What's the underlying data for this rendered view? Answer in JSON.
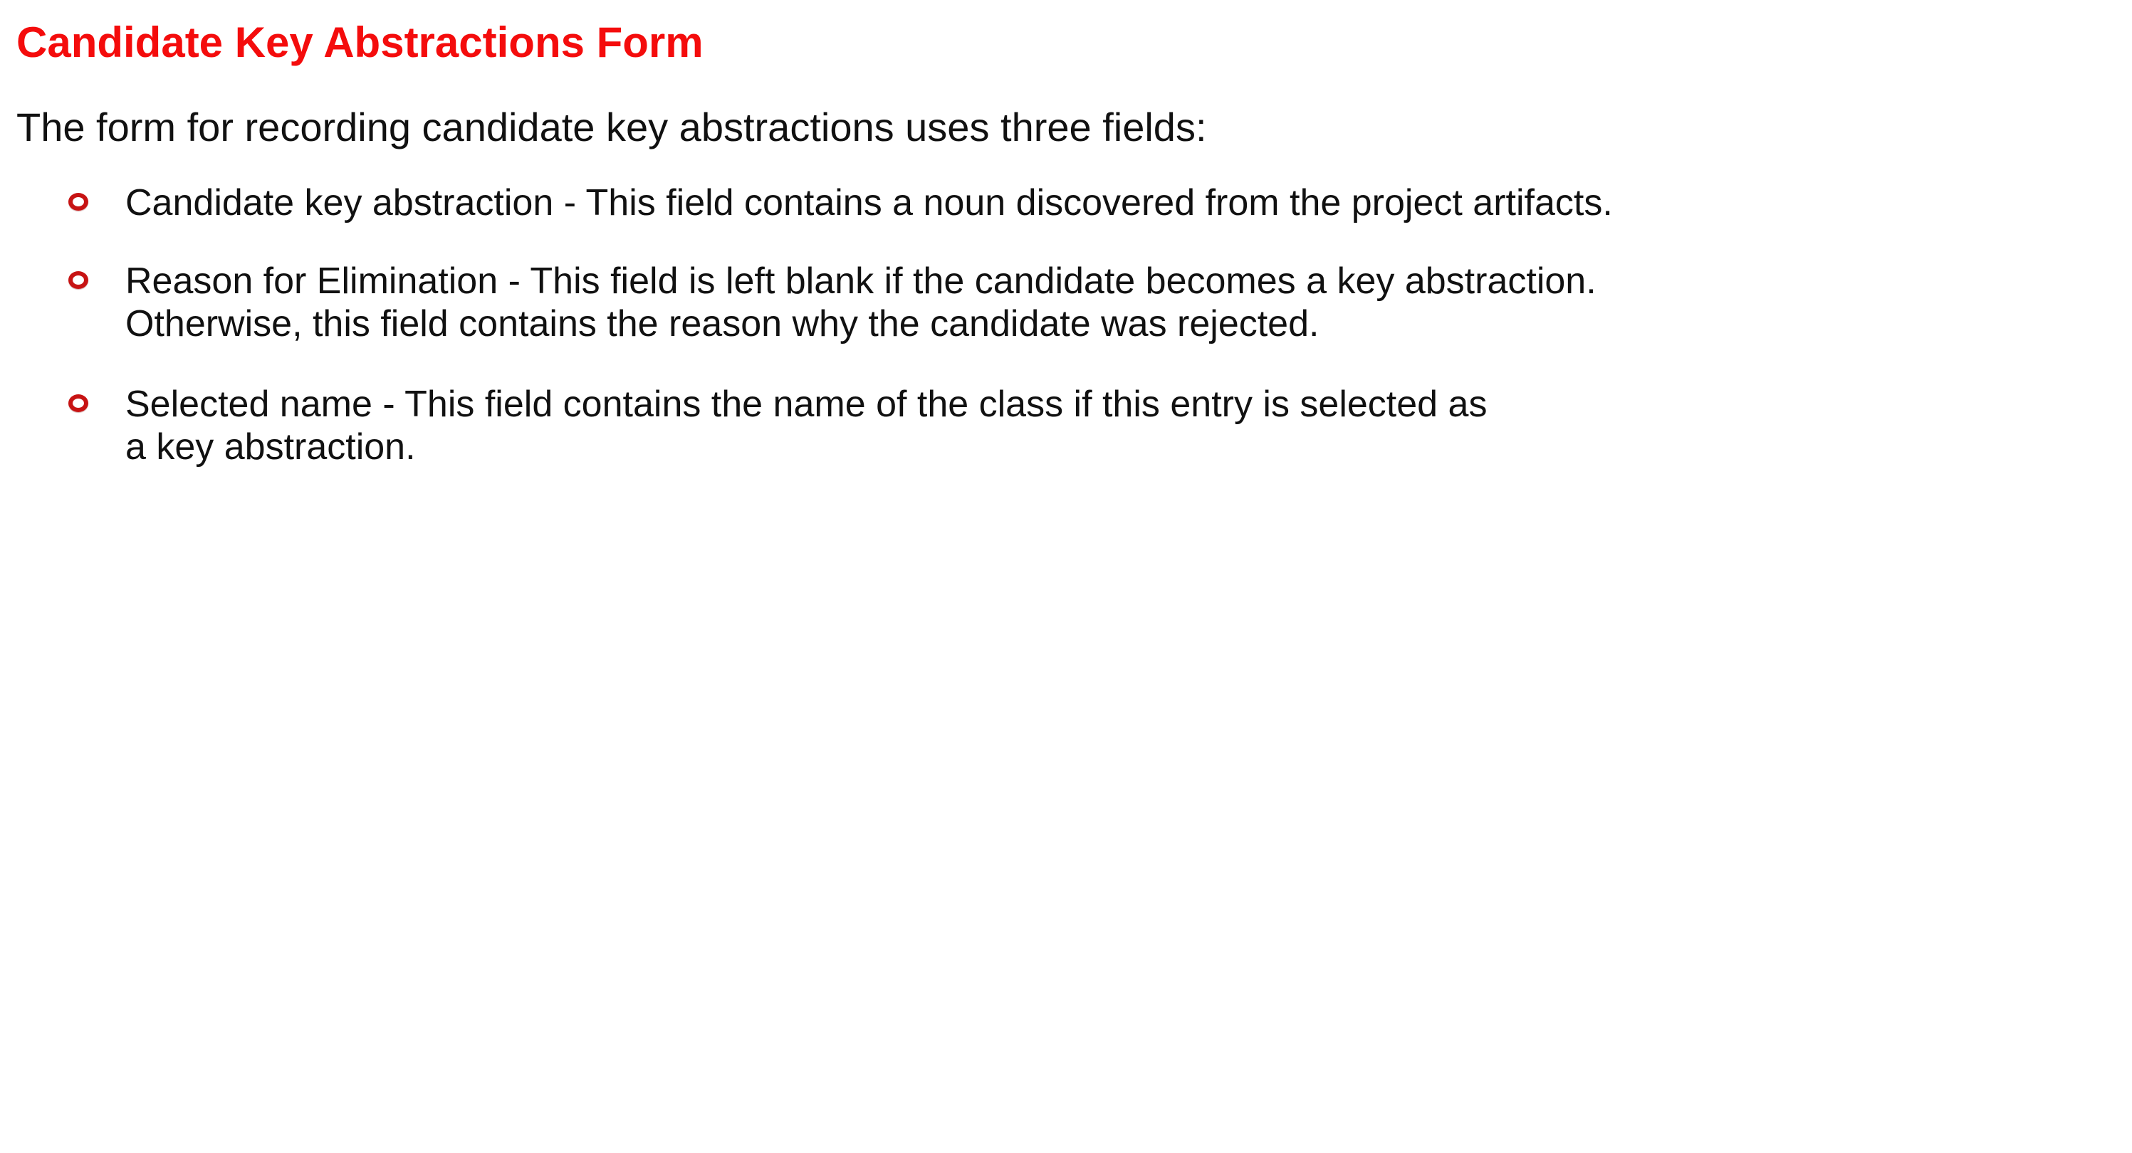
{
  "title": "Candidate Key Abstractions Form",
  "intro": "The form for recording candidate key abstractions uses three fields:",
  "bullets": [
    {
      "lines": [
        "Candidate key abstraction - This field contains a noun discovered from the project artifacts."
      ]
    },
    {
      "lines": [
        "Reason for Elimination - This field is left blank if the candidate becomes a key abstraction.",
        "Otherwise, this field contains the reason why the candidate was rejected."
      ]
    },
    {
      "lines": [
        "Selected name - This field contains the name of the class if this entry is selected as",
        "a key abstraction."
      ]
    }
  ],
  "colors": {
    "title": "#f40c0c",
    "text": "#111111",
    "bullet": "#c71313",
    "background": "#ffffff"
  }
}
